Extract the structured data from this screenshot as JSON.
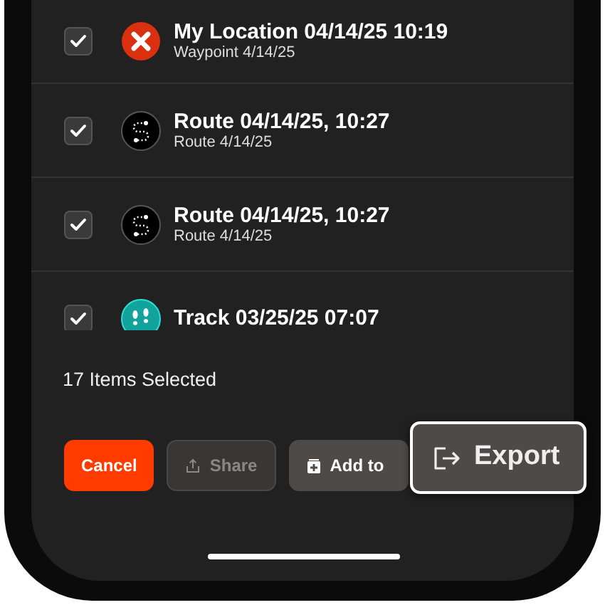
{
  "items": [
    {
      "kind": "waypoint",
      "title": "My Location 04/14/25 10:19",
      "subtitle": "Waypoint 4/14/25",
      "checked": true
    },
    {
      "kind": "route",
      "title": "Route 04/14/25, 10:27",
      "subtitle": "Route 4/14/25",
      "checked": true
    },
    {
      "kind": "route",
      "title": "Route 04/14/25, 10:27",
      "subtitle": "Route 4/14/25",
      "checked": true
    },
    {
      "kind": "track",
      "title": "Track 03/25/25 07:07",
      "checked": true
    }
  ],
  "selection_count": "17 Items Selected",
  "buttons": [
    {
      "kind": "cancel",
      "label": "Cancel",
      "disabled": false
    },
    {
      "kind": "share",
      "label": "Share",
      "disabled": true
    },
    {
      "kind": "add",
      "label": "Add to",
      "disabled": false
    }
  ],
  "export_callout": {
    "label": "Export"
  }
}
